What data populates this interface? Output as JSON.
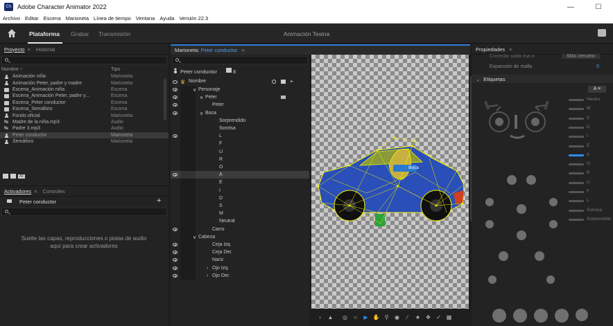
{
  "titlebar": {
    "logo": "Ch",
    "title": "Adobe Character Animator 2022"
  },
  "menu": [
    "Archivo",
    "Editar",
    "Escena",
    "Marioneta",
    "Línea de tiempo",
    "Ventana",
    "Ayuda",
    "Versión 22.3"
  ],
  "workspace": {
    "tabs": [
      "Plataforma",
      "Grabar",
      "Transmisión"
    ],
    "document_title": "Animación Tesina"
  },
  "project_panel": {
    "tabs": [
      "Proyecto",
      "Historial"
    ],
    "columns": {
      "name": "Nombre",
      "type": "Tipo"
    },
    "items": [
      {
        "name": "Animación niña",
        "type": "Marioneta",
        "icon": "puppet"
      },
      {
        "name": "Animación Peter, padre y madre",
        "type": "Marioneta",
        "icon": "puppet"
      },
      {
        "name": "Escena_Animación niña",
        "type": "Escena",
        "icon": "scene"
      },
      {
        "name": "Escena_Animación Peter, padre y...",
        "type": "Escena",
        "icon": "scene"
      },
      {
        "name": "Escena_Peter conductor",
        "type": "Escena",
        "icon": "scene"
      },
      {
        "name": "Escena_Semáforo",
        "type": "Escena",
        "icon": "scene"
      },
      {
        "name": "Fondo oficial",
        "type": "Marioneta",
        "icon": "puppet"
      },
      {
        "name": "Madre de la niña.mp3",
        "type": "Audio",
        "icon": "audio"
      },
      {
        "name": "Padre 3.mp3",
        "type": "Audio",
        "icon": "audio"
      },
      {
        "name": "Peter conductor",
        "type": "Marioneta",
        "icon": "puppet",
        "selected": true
      },
      {
        "name": "Semáforo",
        "type": "Marioneta",
        "icon": "puppet"
      }
    ],
    "footer_badge": "AI"
  },
  "triggers_panel": {
    "tabs": [
      "Activadores",
      "Controles"
    ],
    "puppet": "Peter conductor",
    "add": "+",
    "empty_message_line1": "Suelte las capas, reproducciones o pistas de audio",
    "empty_message_line2": "aquí para crear activadores"
  },
  "puppet_panel": {
    "label": "Marioneta:",
    "value": "Peter conductor",
    "menu": "≡",
    "puppet_name": "Peter conductor",
    "count": "8",
    "column_name": "Nombre",
    "layers": [
      {
        "label": "Personaje",
        "indent": 1,
        "arrow": "v",
        "eye": true
      },
      {
        "label": "Peter",
        "indent": 2,
        "arrow": "v",
        "eye": true
      },
      {
        "label": "Peter",
        "indent": 3,
        "arrow": "",
        "eye": true
      },
      {
        "label": "Boca",
        "indent": 2,
        "arrow": "v",
        "eye": true
      },
      {
        "label": "Sorprendido",
        "indent": 4,
        "arrow": "",
        "eye": false
      },
      {
        "label": "Sonrisa",
        "indent": 4,
        "arrow": "",
        "eye": false
      },
      {
        "label": "L",
        "indent": 4,
        "arrow": "",
        "eye": true
      },
      {
        "label": "F",
        "indent": 4,
        "arrow": "",
        "eye": false
      },
      {
        "label": "U",
        "indent": 4,
        "arrow": "",
        "eye": false
      },
      {
        "label": "R",
        "indent": 4,
        "arrow": "",
        "eye": false
      },
      {
        "label": "O",
        "indent": 4,
        "arrow": "",
        "eye": false
      },
      {
        "label": "A",
        "indent": 4,
        "arrow": "",
        "eye": true,
        "selected": true
      },
      {
        "label": "E",
        "indent": 4,
        "arrow": "",
        "eye": false
      },
      {
        "label": "I",
        "indent": 4,
        "arrow": "",
        "eye": false
      },
      {
        "label": "D",
        "indent": 4,
        "arrow": "",
        "eye": false
      },
      {
        "label": "S",
        "indent": 4,
        "arrow": "",
        "eye": false
      },
      {
        "label": "M",
        "indent": 4,
        "arrow": "",
        "eye": false
      },
      {
        "label": "Neutral",
        "indent": 4,
        "arrow": "",
        "eye": false
      },
      {
        "label": "Carro",
        "indent": 3,
        "arrow": "",
        "eye": true
      },
      {
        "label": "Cabeza",
        "indent": 1,
        "arrow": "v",
        "eye": false
      },
      {
        "label": "Ceja Izq.",
        "indent": 3,
        "arrow": "",
        "eye": true
      },
      {
        "label": "Ceja Der.",
        "indent": 3,
        "arrow": "",
        "eye": true
      },
      {
        "label": "Nariz",
        "indent": 3,
        "arrow": "",
        "eye": true
      },
      {
        "label": "Ojo Izq.",
        "indent": 3,
        "arrow": ">",
        "eye": true
      },
      {
        "label": "Ojo Der.",
        "indent": 3,
        "arrow": ">",
        "eye": true
      }
    ],
    "canvas_label": "Boca"
  },
  "properties_panel": {
    "title": "Propiedades",
    "menu": "≡",
    "cut_line": {
      "label": "Conectar cada risa a",
      "value": "Más cercano"
    },
    "mesh": {
      "label": "Expansión de malla",
      "value": "0"
    },
    "tags_header": "Etiquetas",
    "tags_toggle": "A",
    "tag_labels": [
      "Neutro",
      "M",
      "S",
      "D",
      "I",
      "E",
      "A",
      "O",
      "R",
      "U",
      "F",
      "L",
      "Sonrisa",
      "Sorprendido"
    ]
  }
}
